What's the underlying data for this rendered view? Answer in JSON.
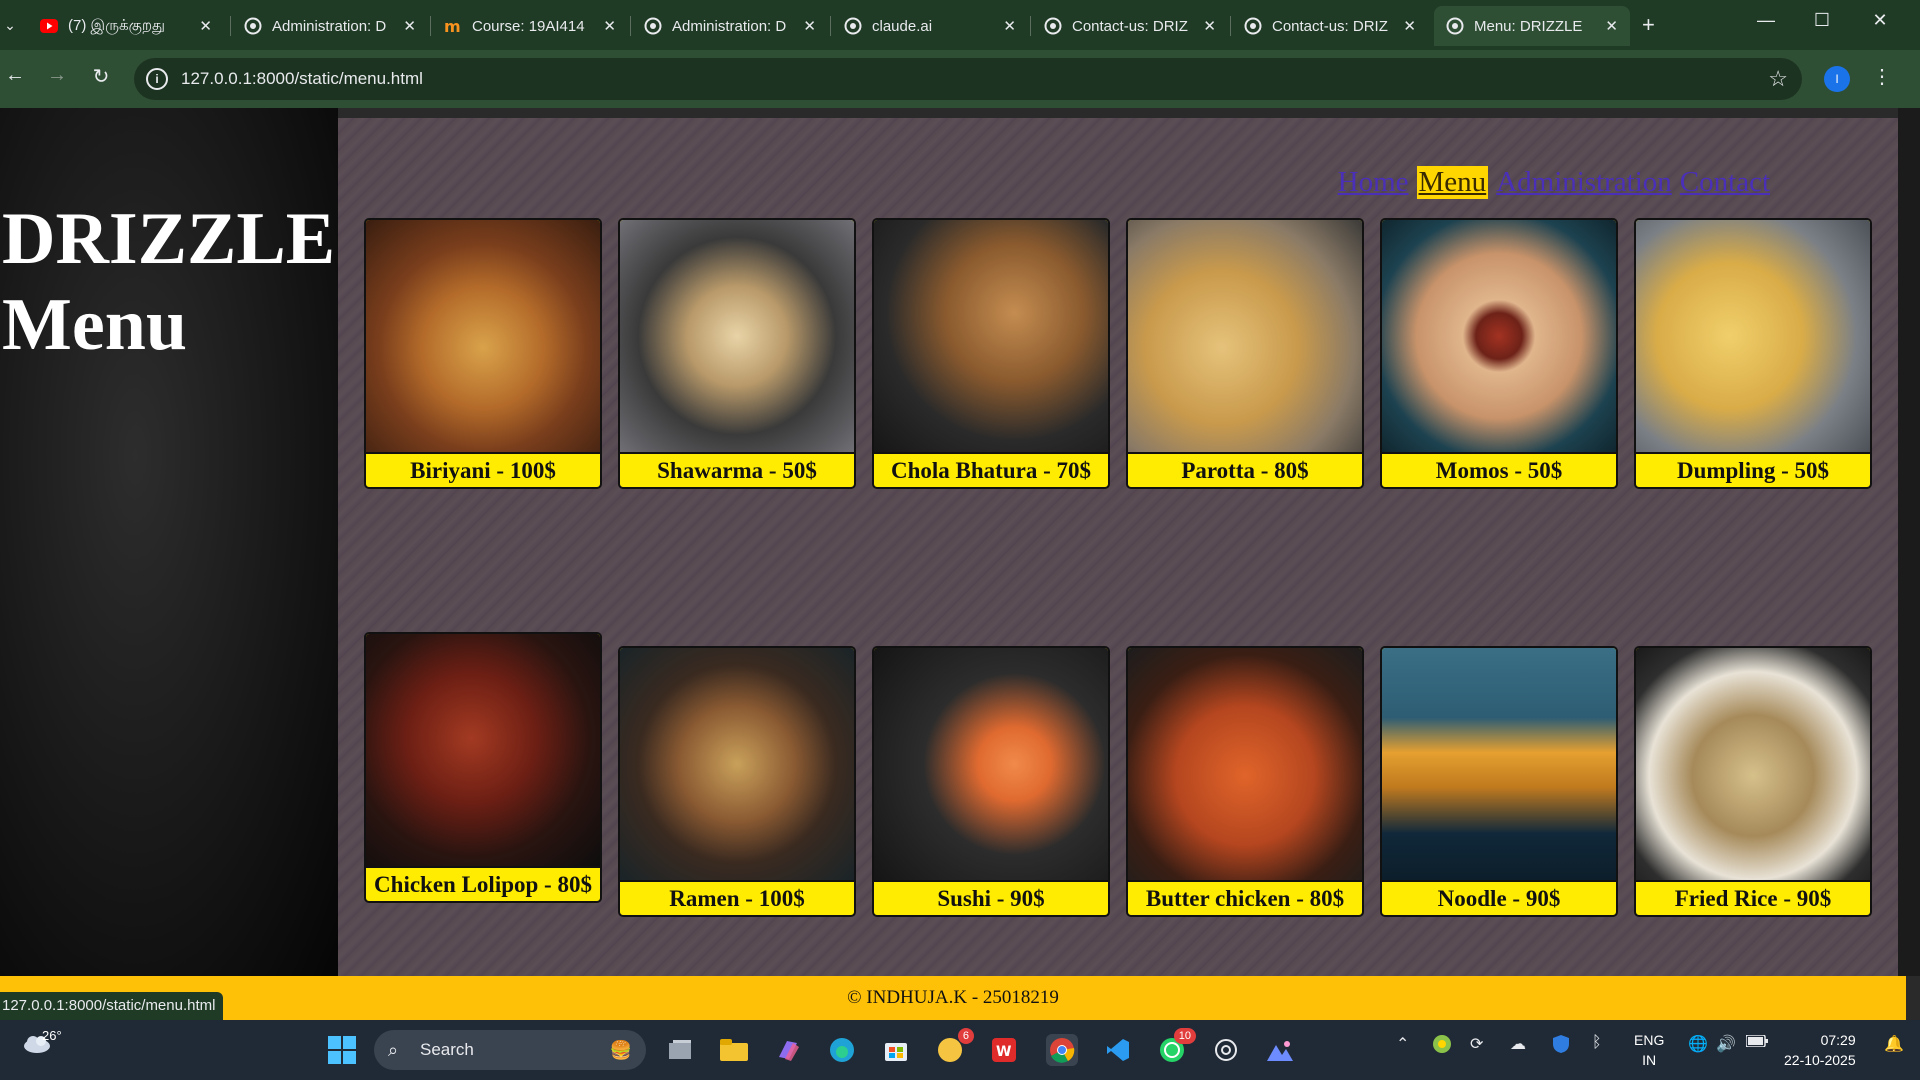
{
  "browser": {
    "tabs": [
      {
        "title": "(7) இருக்குறது",
        "icon": "youtube-icon"
      },
      {
        "title": "Administration: D",
        "icon": "globe-icon"
      },
      {
        "title": "Course: 19AI414",
        "icon": "moodle-icon"
      },
      {
        "title": "Administration: D",
        "icon": "globe-icon"
      },
      {
        "title": "claude.ai",
        "icon": "globe-icon"
      },
      {
        "title": "Contact-us: DRIZ",
        "icon": "globe-icon"
      },
      {
        "title": "Contact-us: DRIZ",
        "icon": "globe-icon"
      },
      {
        "title": "Menu: DRIZZLE",
        "icon": "globe-icon"
      }
    ],
    "url": "127.0.0.1:8000/static/menu.html",
    "profile_initial": "I",
    "status_url": "127.0.0.1:8000/static/menu.html"
  },
  "site": {
    "title_line1": "DRIZZLE",
    "title_line2": "Menu",
    "nav": [
      {
        "label": "Home",
        "current": false
      },
      {
        "label": "Menu",
        "current": true
      },
      {
        "label": "Administration",
        "current": false
      },
      {
        "label": "Contact",
        "current": false
      }
    ],
    "menu": [
      {
        "label": "Biriyani - 100$",
        "image": "biriyani-photo",
        "color": "#8a4a22"
      },
      {
        "label": "Shawarma - 50$",
        "image": "shawarma-photo",
        "color": "#a48358"
      },
      {
        "label": "Chola Bhatura - 70$",
        "image": "chola-bhatura-photo",
        "color": "#7a4e28"
      },
      {
        "label": "Parotta - 80$",
        "image": "parotta-photo",
        "color": "#c9a25a"
      },
      {
        "label": "Momos - 50$",
        "image": "momos-photo",
        "color": "#d4a57c"
      },
      {
        "label": "Dumpling - 50$",
        "image": "dumpling-photo",
        "color": "#d9b45a"
      },
      {
        "label": "Chicken Lolipop - 80$",
        "image": "chicken-lolipop-photo",
        "color": "#6e1f14"
      },
      {
        "label": "Ramen - 100$",
        "image": "ramen-photo",
        "color": "#6b4a2a"
      },
      {
        "label": "Sushi - 90$",
        "image": "sushi-photo",
        "color": "#2c2c2c"
      },
      {
        "label": "Butter chicken - 80$",
        "image": "butter-chicken-photo",
        "color": "#b5461f"
      },
      {
        "label": "Noodle - 90$",
        "image": "noodle-photo",
        "color": "#2d5d73"
      },
      {
        "label": "Fried Rice - 90$",
        "image": "fried-rice-photo",
        "color": "#8c7a5a"
      }
    ],
    "footer": "© INDHUJA.K - 25018219"
  },
  "taskbar": {
    "weather_temp": "26°",
    "search_placeholder": "Search",
    "badges": {
      "notifications": "6",
      "whatsapp": "10"
    },
    "lang_line1": "ENG",
    "lang_line2": "IN",
    "time": "07:29",
    "date": "22-10-2025"
  }
}
